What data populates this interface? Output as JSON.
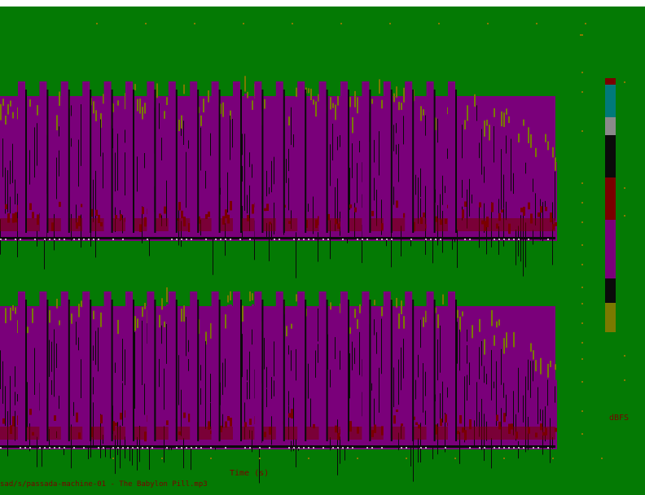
{
  "colors": {
    "background": "#047A04",
    "page_strip": "#FFFFFF",
    "label_text": "#7A0000",
    "tick_mark": "#8A7A00",
    "palette": [
      "#7A7A00",
      "#0A0A0A",
      "#7A007A",
      "#7A0000",
      "#0A0A0A",
      "#8A8A8A",
      "#007A7A",
      "#7A0000"
    ]
  },
  "chart_data": {
    "type": "heatmap",
    "title": "",
    "panels": [
      {
        "name": "",
        "xlabel": "",
        "ylabel": ""
      },
      {
        "name": "",
        "xlabel": "Time (s)",
        "ylabel": ""
      }
    ],
    "grid": false,
    "colorbar": {
      "placement": "right",
      "label": "dBFS",
      "colors": [
        "#7A7A00",
        "#0A0A0A",
        "#7A007A",
        "#7A0000",
        "#0A0A0A",
        "#8A8A8A",
        "#007A7A",
        "#7A0000"
      ]
    },
    "peak_columns": 21,
    "profile": [
      0.82,
      0.86,
      0.84,
      0.88,
      0.9,
      0.87,
      0.85,
      0.89,
      0.91,
      0.88,
      0.86,
      0.9,
      0.92,
      0.89,
      0.87,
      0.9,
      0.88,
      0.86,
      0.89,
      0.91,
      0.9,
      0.88,
      0.87,
      0.85,
      0.78,
      0.7,
      0.6,
      0.5
    ]
  },
  "footer": {
    "file_label": "sad/s/passada-machine-01 - The Babylon Pill.mp3"
  }
}
